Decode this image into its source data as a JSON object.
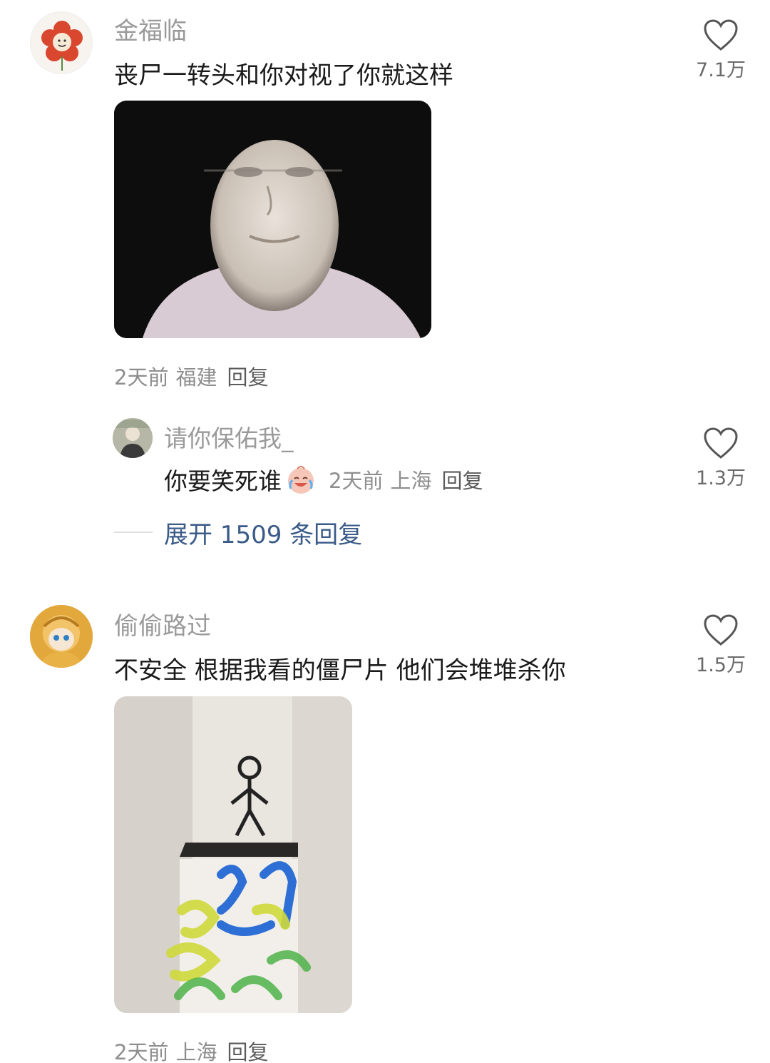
{
  "comments": [
    {
      "username": "金福临",
      "text": "丧尸一转头和你对视了你就这样",
      "likes": "7.1万",
      "time": "2天前",
      "location": "福建",
      "reply_label": "回复",
      "reply": {
        "username": "请你保佑我_",
        "text": "你要笑死谁",
        "emoji": "crying-laughing-face-icon",
        "time": "2天前",
        "location": "上海",
        "reply_label": "回复",
        "likes": "1.3万"
      },
      "expand_label": "展开 1509 条回复"
    },
    {
      "username": "偷偷路过",
      "text": "不安全 根据我看的僵尸片 他们会堆堆杀你",
      "likes": "1.5万",
      "time": "2天前",
      "location": "上海",
      "reply_label": "回复"
    }
  ],
  "colors": {
    "username": "#9a9a9a",
    "meta": "#8e8e8e",
    "expand_link": "#3a5a88",
    "reply_action": "#5a5a5a"
  }
}
